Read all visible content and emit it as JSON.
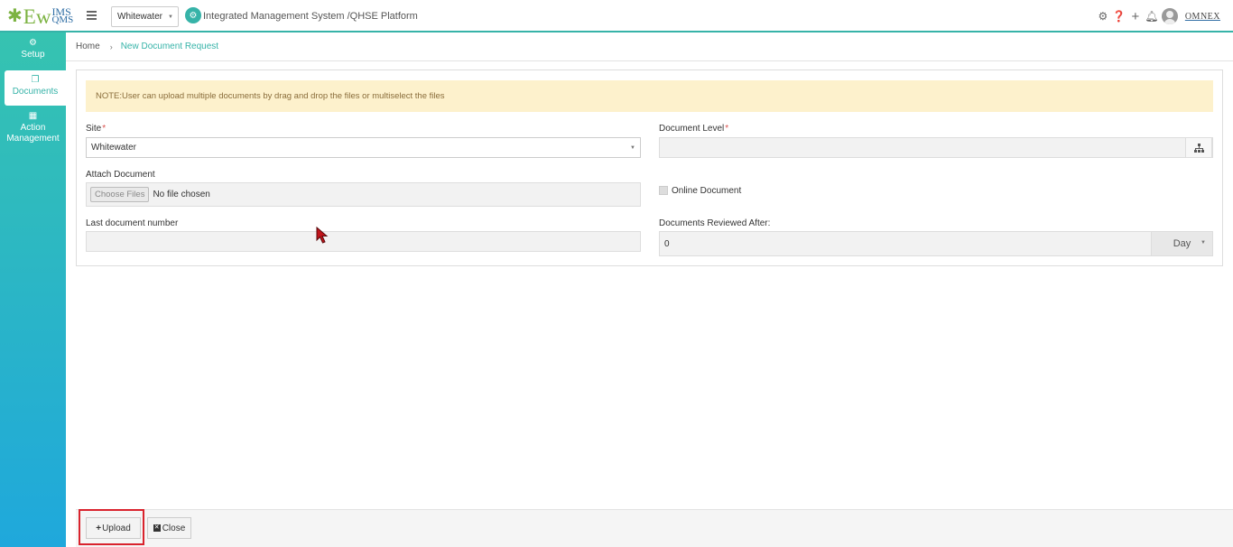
{
  "header": {
    "logo_main": "Ew",
    "logo_top": "IMS",
    "logo_bottom": "QMS",
    "site": "Whitewater",
    "platform_title": "Integrated Management System /QHSE Platform",
    "brand": "OMNEX"
  },
  "sidebar": {
    "items": [
      {
        "label": "Setup",
        "icon": "gears-icon"
      },
      {
        "label": "Documents",
        "icon": "documents-icon"
      },
      {
        "label": "Action Management",
        "icon": "building-icon"
      }
    ]
  },
  "breadcrumb": {
    "home": "Home",
    "current": "New Document Request"
  },
  "note": "NOTE:User can upload multiple documents by drag and drop the files or multiselect the files",
  "form": {
    "site_label": "Site",
    "site_value": "Whitewater",
    "doc_level_label": "Document Level",
    "doc_level_value": "",
    "attach_label": "Attach Document",
    "choose_files": "Choose Files",
    "no_file": "No file chosen",
    "online_doc_label": "Online Document",
    "last_doc_label": "Last document number",
    "last_doc_value": "",
    "reviewed_label": "Documents Reviewed After:",
    "reviewed_value": "0",
    "reviewed_unit": "Day",
    "required_marker": "*"
  },
  "footer": {
    "upload": "Upload",
    "close": "Close"
  },
  "colors": {
    "accent": "#36b3a8",
    "note_bg": "#fdf1cc",
    "highlight": "#d9232d"
  }
}
